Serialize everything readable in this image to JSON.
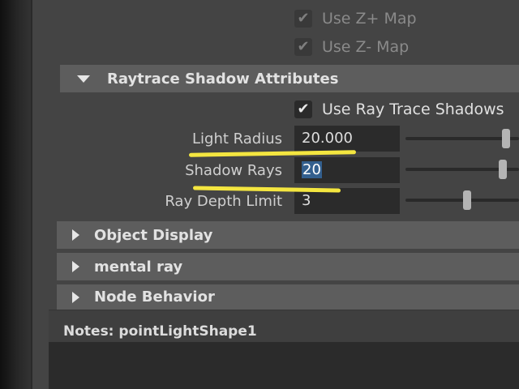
{
  "shadow_map": {
    "use_z_plus": {
      "label": "Use Z+ Map",
      "checked": true
    },
    "use_z_minus": {
      "label": "Use Z- Map",
      "checked": true
    }
  },
  "raytrace": {
    "title": "Raytrace Shadow Attributes",
    "use_ray_trace": {
      "label": "Use Ray Trace Shadows",
      "checked": true
    },
    "light_radius": {
      "label": "Light Radius",
      "value": "20.000",
      "slider_fraction": 0.9
    },
    "shadow_rays": {
      "label": "Shadow Rays",
      "value": "20",
      "slider_fraction": 0.86
    },
    "ray_depth_limit": {
      "label": "Ray Depth Limit",
      "value": "3",
      "slider_fraction": 0.54
    }
  },
  "sections": [
    {
      "title": "Object Display"
    },
    {
      "title": "mental ray"
    },
    {
      "title": "Node Behavior"
    }
  ],
  "notes": {
    "label": "Notes:  pointLightShape1"
  },
  "colors": {
    "highlight": "#f4e640",
    "selection": "#335f8e"
  },
  "icons": {
    "checkbox": "checkmark-icon",
    "expanded": "triangle-down-icon",
    "collapsed": "triangle-right-icon"
  }
}
